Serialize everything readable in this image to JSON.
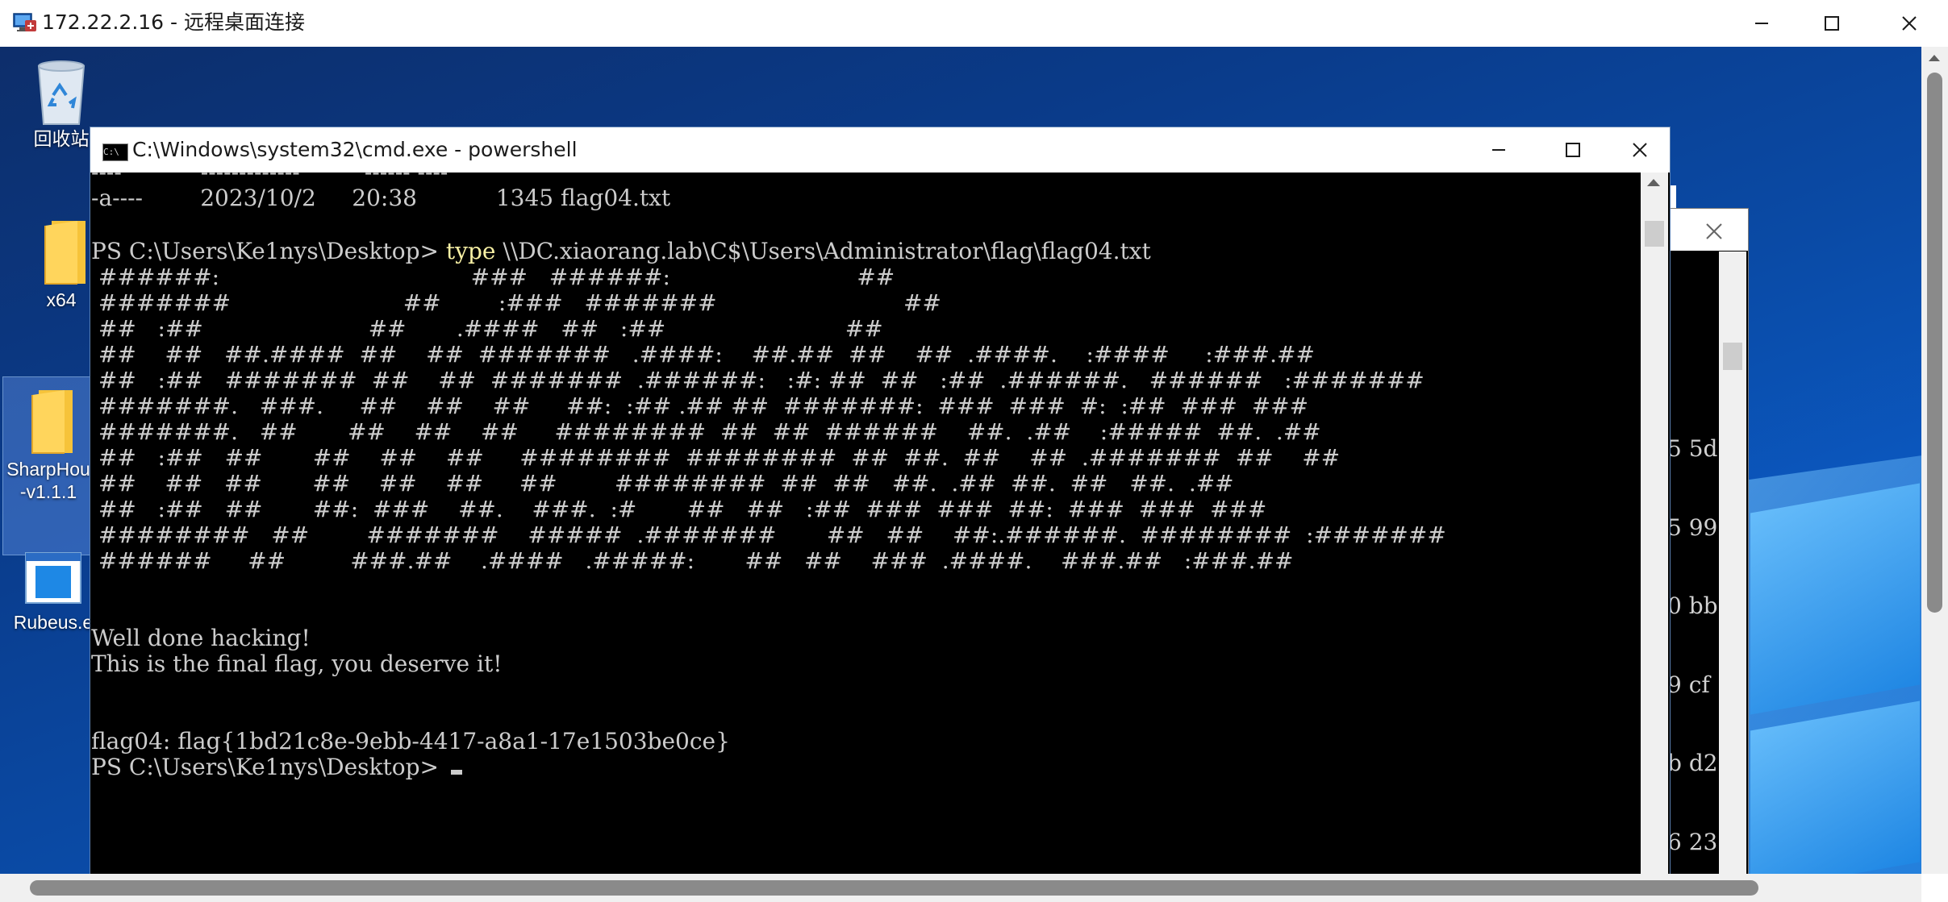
{
  "rdp": {
    "title": "172.22.2.16 - 远程桌面连接",
    "icon": "remote-desktop-icon"
  },
  "desktop": {
    "icons": [
      {
        "name": "recycle-bin",
        "label": "回收站",
        "icon": "recycle-bin-icon"
      },
      {
        "name": "x64",
        "label": "x64",
        "icon": "folder-icon"
      },
      {
        "name": "sharphound",
        "label1": "SharpHou",
        "label2": "-v1.1.1",
        "icon": "folder-icon"
      },
      {
        "name": "rubeus",
        "label": "Rubeus.e",
        "icon": "executable-icon"
      }
    ]
  },
  "console": {
    "title": "C:\\Windows\\system32\\cmd.exe - powershell",
    "title_icon_text": "C:\\",
    "lines": [
      "----           -------------         ------ ----",
      "-a----        2023/10/2     20:38           1345 flag04.txt",
      "",
      "",
      "",
      " ######:                                   ###   ######:                          ##",
      " #######                        ##        :###   #######                          ##",
      " ##   :##                       ##       .####   ##   :##                         ##",
      " ##    ##   ##.####  ##    ##  #######   .####:    ##.##  ##    ##  .####.    :####     :###.##",
      " ##   :##   #######  ##    ##  #######  .######:   :#: ##  ##   :##  .######.   ######   :#######",
      " #######.   ###.     ##    ##    ##     ##:  :## .## ##  #######:  ###  ###  #:  :##  ###  ###",
      " #######.   ##       ##    ##    ##     ########  ##  ##  ######    ##.  .##    :#####  ##.  .##",
      " ##   :##   ##       ##    ##    ##     ########  ########  ##  ##.  ##    ##  .#######  ##    ##",
      " ##    ##   ##       ##    ##    ##     ##        ########  ##  ##   ##.  .##  ##.  ##   ##.  .##",
      " ##   :##   ##       ##:  ###    ##.    ###.  :#       ##   ##   :##  ###  ###  ##:  ###  ###  ###",
      " ########   ##        #######    #####  .#######       ##   ##    ##:.######.  ########  :#######",
      " ######     ##         ###.##    .####   .#####:       ##   ##    ###  .####.    ###.##   :###.##",
      "",
      "",
      "Well done hacking!",
      "This is the final flag, you deserve it!",
      "",
      "",
      "flag04: flag{1bd21c8e-9ebb-4417-a8a1-17e1503be0ce}"
    ],
    "cmd_prompt": "PS C:\\Users\\Ke1nys\\Desktop> ",
    "cmd_keyword": "type",
    "cmd_args": " \\\\DC.xiaorang.lab\\C$\\Users\\Administrator\\flag\\flag04.txt",
    "final_prompt": "PS C:\\Users\\Ke1nys\\Desktop> "
  },
  "back_window": {
    "lines": [
      "5 5d",
      "5 99",
      "0 bb",
      "9 cf",
      "b d2",
      "6 23"
    ]
  }
}
